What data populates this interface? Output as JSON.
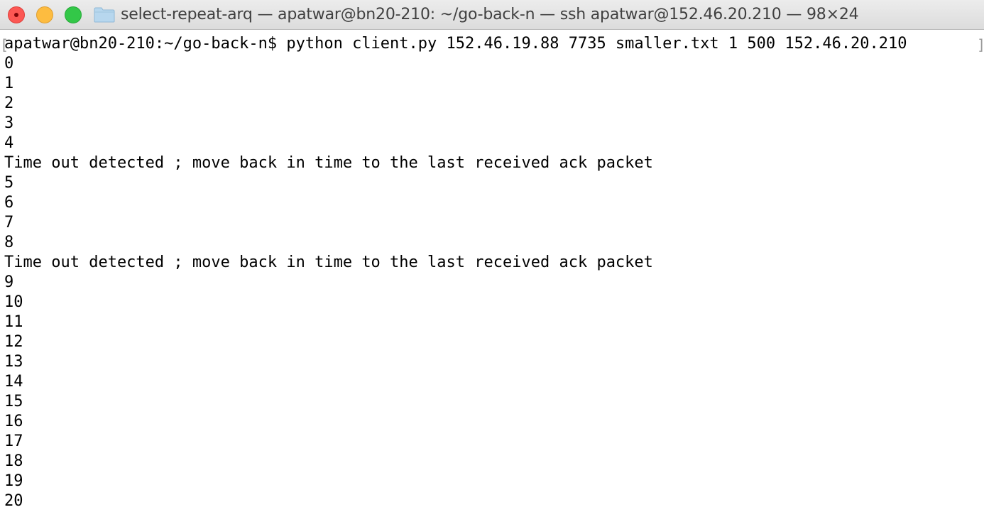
{
  "window": {
    "title": "select-repeat-arq — apatwar@bn20-210: ~/go-back-n — ssh apatwar@152.46.20.210 — 98×24",
    "folder_icon": "folder-icon"
  },
  "terminal": {
    "lines": [
      "apatwar@bn20-210:~/go-back-n$ python client.py 152.46.19.88 7735 smaller.txt 1 500 152.46.20.210",
      "0",
      "1",
      "2",
      "3",
      "4",
      "Time out detected ; move back in time to the last received ack packet",
      "5",
      "6",
      "7",
      "8",
      "Time out detected ; move back in time to the last received ack packet",
      "9",
      "10",
      "11",
      "12",
      "13",
      "14",
      "15",
      "16",
      "17",
      "18",
      "19",
      "20"
    ]
  },
  "colors": {
    "close": "#fc5753",
    "minimize": "#fdbc40",
    "zoom": "#33c748",
    "folder": "#b7d7ee",
    "text": "#000000",
    "background": "#ffffff"
  }
}
